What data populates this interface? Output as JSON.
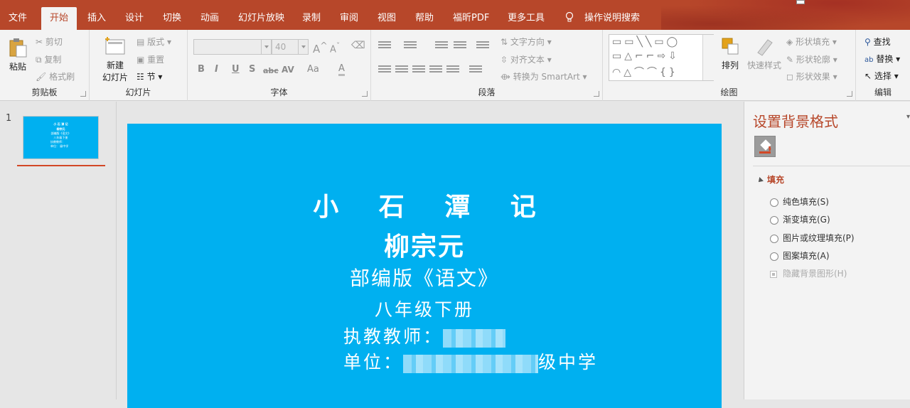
{
  "tabs": [
    "文件",
    "开始",
    "插入",
    "设计",
    "切换",
    "动画",
    "幻灯片放映",
    "录制",
    "审阅",
    "视图",
    "帮助",
    "福昕PDF",
    "更多工具"
  ],
  "active_tab": "开始",
  "tell_me": "操作说明搜索",
  "ribbon": {
    "clipboard": {
      "paste": "粘贴",
      "cut": "剪切",
      "copy": "复制",
      "format_painter": "格式刷",
      "label": "剪贴板"
    },
    "slides": {
      "new_slide_line1": "新建",
      "new_slide_line2": "幻灯片",
      "layout": "版式",
      "reset": "重置",
      "section": "节",
      "label": "幻灯片"
    },
    "font": {
      "font_name": "",
      "font_size": "40",
      "grow": "A",
      "shrink": "A",
      "bold": "B",
      "italic": "I",
      "underline": "U",
      "shadow": "S",
      "strike": "abc",
      "spacing": "AV",
      "case": "Aa",
      "color": "A",
      "label": "字体"
    },
    "paragraph": {
      "text_direction": "文字方向",
      "align_text": "对齐文本",
      "smartart": "转换为 SmartArt",
      "label": "段落"
    },
    "drawing": {
      "arrange": "排列",
      "quick_styles": "快速样式",
      "shape_fill": "形状填充",
      "shape_outline": "形状轮廓",
      "shape_effects": "形状效果",
      "label": "绘图"
    },
    "editing": {
      "find": "查找",
      "replace": "替换",
      "select": "选择",
      "label": "编辑"
    }
  },
  "thumbnails": {
    "slide_number": "1",
    "lines": [
      "小 石 潭 记",
      "柳宗元",
      "部编版《语文》",
      "八年级下册",
      "执教教师：",
      "单位：  级中学"
    ]
  },
  "slide": {
    "line1": "小 石 潭 记",
    "line2": "柳宗元",
    "line3": "部编版《语文》",
    "line4": "八年级下册",
    "teacher_label": "执教教师：",
    "unit_label": "单位：",
    "unit_suffix": "级中学",
    "background": "#00b0f0"
  },
  "format_pane": {
    "title": "设置背景格式",
    "section": "填充",
    "options": [
      "纯色填充(S)",
      "渐变填充(G)",
      "图片或纹理填充(P)",
      "图案填充(A)"
    ],
    "hide_bg_graphics": "隐藏背景图形(H)"
  },
  "colors": {
    "accent": "#b7472a",
    "slide_bg": "#00b0f0",
    "ribbon_bg": "#f3f3f3"
  }
}
